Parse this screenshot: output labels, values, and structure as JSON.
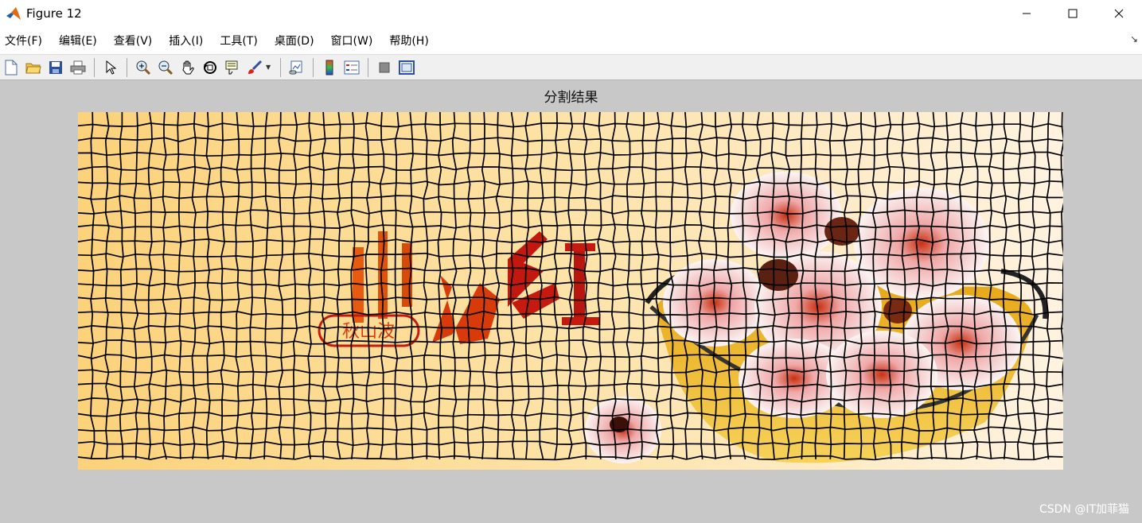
{
  "window": {
    "title": "Figure 12",
    "icon": "matlab-logo-icon"
  },
  "menu": {
    "items": [
      {
        "label": "文件(F)"
      },
      {
        "label": "编辑(E)"
      },
      {
        "label": "查看(V)"
      },
      {
        "label": "插入(I)"
      },
      {
        "label": "工具(T)"
      },
      {
        "label": "桌面(D)"
      },
      {
        "label": "窗口(W)"
      },
      {
        "label": "帮助(H)"
      }
    ],
    "corner_icon": "dock-arrow-icon"
  },
  "toolbar": {
    "buttons": [
      "new-figure-icon",
      "open-file-icon",
      "save-icon",
      "print-icon",
      "pointer-icon",
      "zoom-in-icon",
      "zoom-out-icon",
      "pan-hand-icon",
      "rotate-3d-icon",
      "data-cursor-icon",
      "brush-icon",
      "link-plot-icon",
      "colorbar-icon",
      "legend-icon",
      "hide-plot-tools-icon",
      "show-plot-tools-icon"
    ]
  },
  "axes": {
    "title": "分割结果"
  },
  "image": {
    "text_main": "川椿红",
    "stamp_text": "秋山波"
  },
  "watermark": "CSDN @IT加菲猫",
  "colors": {
    "background": "#c8c8c8",
    "toolbar": "#f0f0f0",
    "image_bg_left": "#fcd27a",
    "image_bg_right": "#fff1dc",
    "grid_line": "#000000",
    "text_orange": "#e85a10",
    "text_red": "#c61a10"
  }
}
